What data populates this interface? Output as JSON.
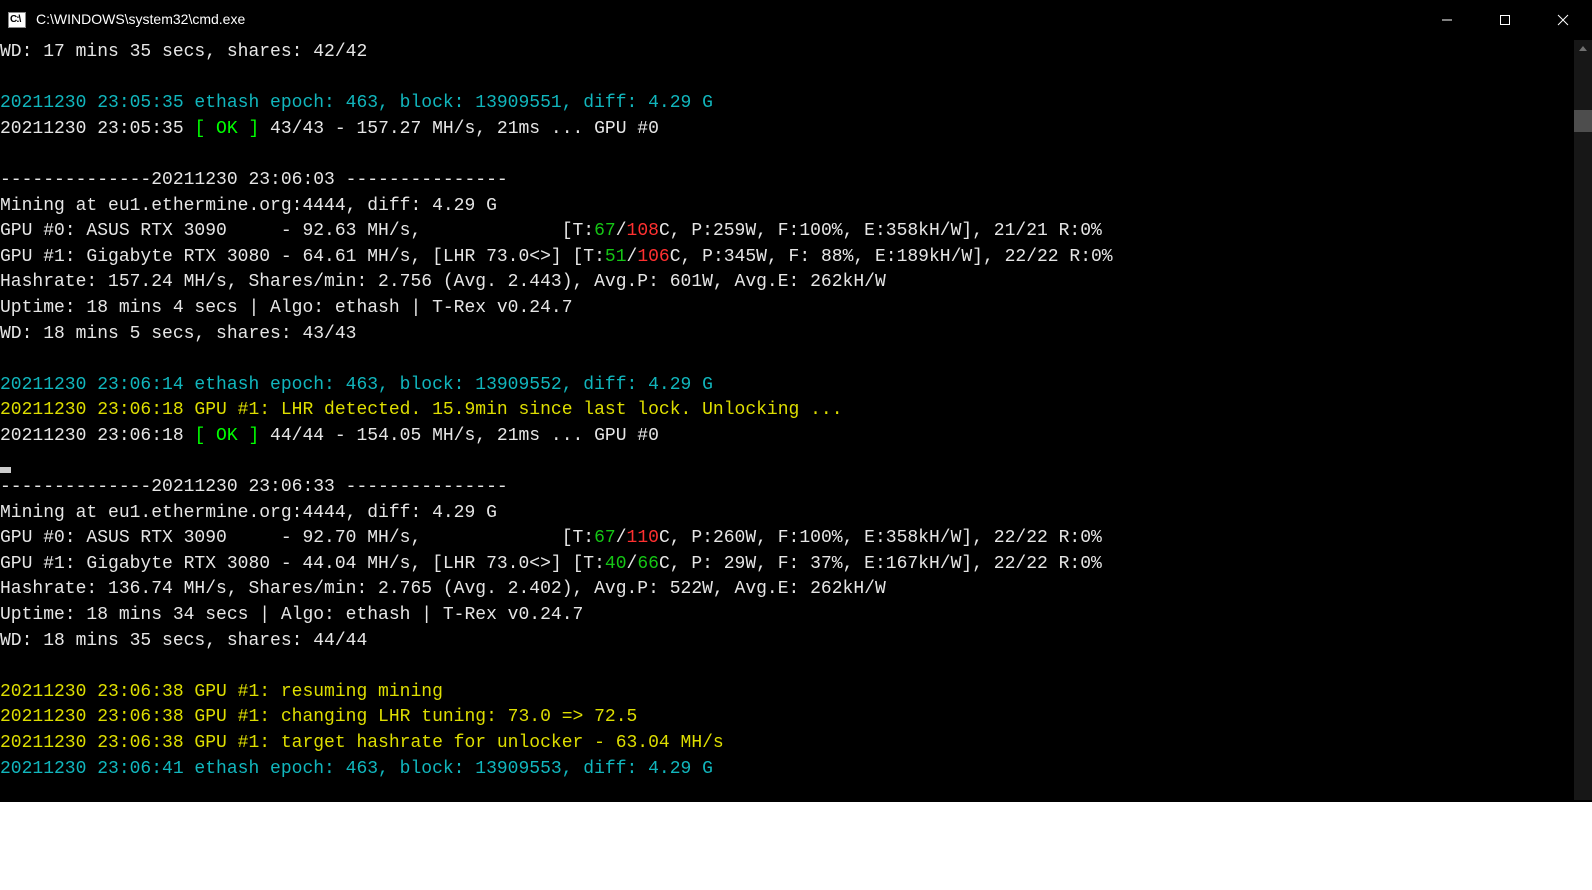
{
  "window": {
    "title": "C:\\WINDOWS\\system32\\cmd.exe",
    "icon_label": "C:\\"
  },
  "lines": [
    {
      "segments": [
        {
          "cls": "white",
          "text": "WD: 17 mins 35 secs, shares: 42/42"
        }
      ]
    },
    {
      "segments": [
        {
          "cls": "white",
          "text": ""
        }
      ]
    },
    {
      "segments": [
        {
          "cls": "cyan",
          "text": "20211230 23:05:35 ethash epoch: 463, block: 13909551, diff: 4.29 G"
        }
      ]
    },
    {
      "segments": [
        {
          "cls": "white",
          "text": "20211230 23:05:35 "
        },
        {
          "cls": "green",
          "text": "[ OK ]"
        },
        {
          "cls": "white",
          "text": " 43/43 - 157.27 MH/s, 21ms ... GPU #0"
        }
      ]
    },
    {
      "segments": [
        {
          "cls": "white",
          "text": ""
        }
      ]
    },
    {
      "segments": [
        {
          "cls": "white",
          "text": "--------------20211230 23:06:03 ---------------"
        }
      ]
    },
    {
      "segments": [
        {
          "cls": "white",
          "text": "Mining at eu1.ethermine.org:4444, diff: 4.29 G"
        }
      ]
    },
    {
      "segments": [
        {
          "cls": "white",
          "text": "GPU #0: ASUS RTX 3090     - 92.63 MH/s,             [T:"
        },
        {
          "cls": "darkgreen",
          "text": "67"
        },
        {
          "cls": "white",
          "text": "/"
        },
        {
          "cls": "red",
          "text": "108"
        },
        {
          "cls": "white",
          "text": "C, P:259W, F:100%, E:358kH/W], 21/21 R:0%"
        }
      ]
    },
    {
      "segments": [
        {
          "cls": "white",
          "text": "GPU #1: Gigabyte RTX 3080 - 64.61 MH/s, [LHR 73.0<>] [T:"
        },
        {
          "cls": "darkgreen",
          "text": "51"
        },
        {
          "cls": "white",
          "text": "/"
        },
        {
          "cls": "red",
          "text": "106"
        },
        {
          "cls": "white",
          "text": "C, P:345W, F: 88%, E:189kH/W], 22/22 R:0%"
        }
      ]
    },
    {
      "segments": [
        {
          "cls": "white",
          "text": "Hashrate: 157.24 MH/s, Shares/min: 2.756 (Avg. 2.443), Avg.P: 601W, Avg.E: 262kH/W"
        }
      ]
    },
    {
      "segments": [
        {
          "cls": "white",
          "text": "Uptime: 18 mins 4 secs | Algo: ethash | T-Rex v0.24.7"
        }
      ]
    },
    {
      "segments": [
        {
          "cls": "white",
          "text": "WD: 18 mins 5 secs, shares: 43/43"
        }
      ]
    },
    {
      "segments": [
        {
          "cls": "white",
          "text": ""
        }
      ]
    },
    {
      "segments": [
        {
          "cls": "cyan",
          "text": "20211230 23:06:14 ethash epoch: 463, block: 13909552, diff: 4.29 G"
        }
      ]
    },
    {
      "segments": [
        {
          "cls": "yellow",
          "text": "20211230 23:06:18 GPU #1: LHR detected. 15.9min since last lock. Unlocking ..."
        }
      ]
    },
    {
      "segments": [
        {
          "cls": "white",
          "text": "20211230 23:06:18 "
        },
        {
          "cls": "green",
          "text": "[ OK ]"
        },
        {
          "cls": "white",
          "text": " 44/44 - 154.05 MH/s, 21ms ... GPU #0"
        }
      ]
    },
    {
      "segments": [
        {
          "cls": "white",
          "text": "",
          "cursor": true
        }
      ]
    },
    {
      "segments": [
        {
          "cls": "white",
          "text": "--------------20211230 23:06:33 ---------------"
        }
      ]
    },
    {
      "segments": [
        {
          "cls": "white",
          "text": "Mining at eu1.ethermine.org:4444, diff: 4.29 G"
        }
      ]
    },
    {
      "segments": [
        {
          "cls": "white",
          "text": "GPU #0: ASUS RTX 3090     - 92.70 MH/s,             [T:"
        },
        {
          "cls": "darkgreen",
          "text": "67"
        },
        {
          "cls": "white",
          "text": "/"
        },
        {
          "cls": "red",
          "text": "110"
        },
        {
          "cls": "white",
          "text": "C, P:260W, F:100%, E:358kH/W], 22/22 R:0%"
        }
      ]
    },
    {
      "segments": [
        {
          "cls": "white",
          "text": "GPU #1: Gigabyte RTX 3080 - 44.04 MH/s, [LHR 73.0<>] [T:"
        },
        {
          "cls": "darkgreen",
          "text": "40"
        },
        {
          "cls": "white",
          "text": "/"
        },
        {
          "cls": "darkgreen",
          "text": "66"
        },
        {
          "cls": "white",
          "text": "C, P: 29W, F: 37%, E:167kH/W], 22/22 R:0%"
        }
      ]
    },
    {
      "segments": [
        {
          "cls": "white",
          "text": "Hashrate: 136.74 MH/s, Shares/min: 2.765 (Avg. 2.402), Avg.P: 522W, Avg.E: 262kH/W"
        }
      ]
    },
    {
      "segments": [
        {
          "cls": "white",
          "text": "Uptime: 18 mins 34 secs | Algo: ethash | T-Rex v0.24.7"
        }
      ]
    },
    {
      "segments": [
        {
          "cls": "white",
          "text": "WD: 18 mins 35 secs, shares: 44/44"
        }
      ]
    },
    {
      "segments": [
        {
          "cls": "white",
          "text": ""
        }
      ]
    },
    {
      "segments": [
        {
          "cls": "yellow",
          "text": "20211230 23:06:38 GPU #1: resuming mining"
        }
      ]
    },
    {
      "segments": [
        {
          "cls": "yellow",
          "text": "20211230 23:06:38 GPU #1: changing LHR tuning: 73.0 => 72.5"
        }
      ]
    },
    {
      "segments": [
        {
          "cls": "yellow",
          "text": "20211230 23:06:38 GPU #1: target hashrate for unlocker - 63.04 MH/s"
        }
      ]
    },
    {
      "segments": [
        {
          "cls": "cyan",
          "text": "20211230 23:06:41 ethash epoch: 463, block: 13909553, diff: 4.29 G"
        }
      ]
    }
  ]
}
